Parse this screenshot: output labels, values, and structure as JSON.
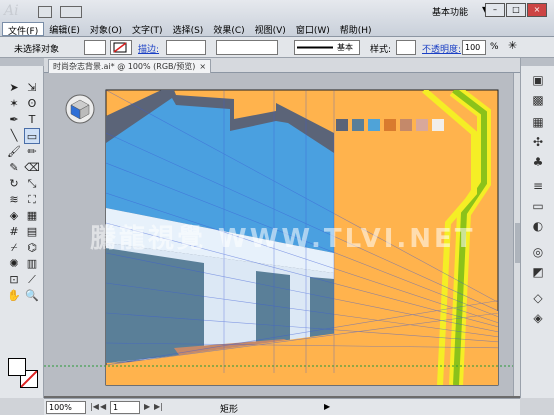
{
  "app": {
    "logo_text": "Ai",
    "workspace": "基本功能"
  },
  "menu": [
    "文件(F)",
    "编辑(E)",
    "对象(O)",
    "文字(T)",
    "选择(S)",
    "效果(C)",
    "视图(V)",
    "窗口(W)",
    "帮助(H)"
  ],
  "control_bar": {
    "selection_status": "未选择对象",
    "stroke_label": "描边:",
    "brush_label": "基本",
    "style_label": "样式:",
    "opacity_label": "不透明度:",
    "opacity_value": "100",
    "opacity_unit": "%"
  },
  "tab": {
    "title": "时尚杂志背景.ai* @ 100% (RGB/预览)",
    "close": "×"
  },
  "status": {
    "zoom": "100%",
    "page": "1",
    "tool_name": "矩形"
  },
  "palette": [
    "#5b6478",
    "#5a7f98",
    "#4fa3d8",
    "#d97b2e",
    "#c4896a",
    "#d8a89b",
    "#f1eee9"
  ],
  "watermark": "騰龍視覺 WWW.TLVI.NET",
  "colors": {
    "orange": "#ffb34d",
    "blue": "#4aa0e0",
    "dark": "#5b6478",
    "green": "#8cc21a",
    "yellow": "#f5ee25"
  }
}
